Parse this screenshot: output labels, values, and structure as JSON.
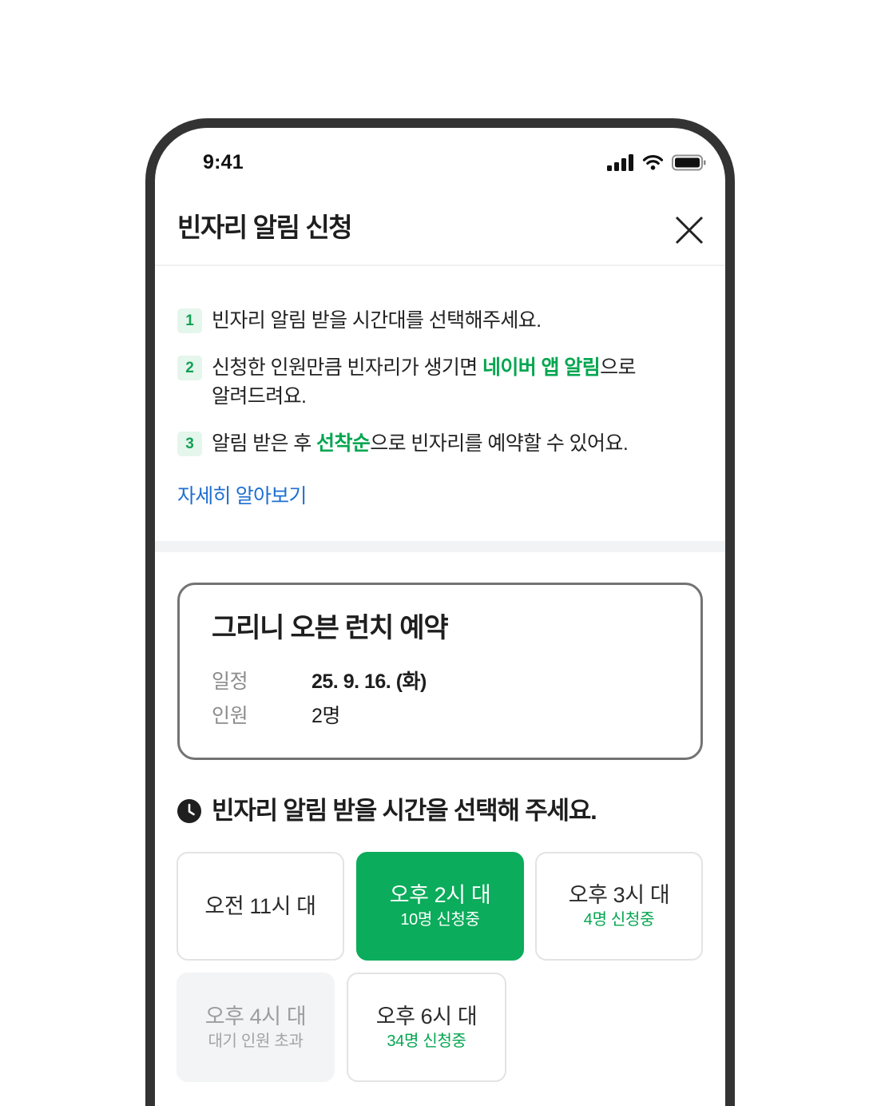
{
  "status_bar": {
    "time": "9:41",
    "icons": [
      "cellular-signal-icon",
      "wifi-icon",
      "battery-icon"
    ]
  },
  "header": {
    "title": "빈자리 알림 신청",
    "close_icon": "close-icon"
  },
  "steps": [
    {
      "number": "1",
      "text": "빈자리 알림 받을 시간대를 선택해주세요."
    },
    {
      "number": "2",
      "before": "신청한 인원만큼 빈자리가 생기면 ",
      "highlight": "네이버 앱 알림",
      "after": "으로 알려드려요."
    },
    {
      "number": "3",
      "before": "알림 받은 후 ",
      "highlight": "선착순",
      "after": "으로 빈자리를 예약할 수 있어요."
    }
  ],
  "learn_more_link": "자세히 알아보기",
  "reservation": {
    "title": "그리니 오븐 런치 예약",
    "rows": [
      {
        "label": "일정",
        "value": "25. 9. 16. (화)"
      },
      {
        "label": "인원",
        "value": "2명"
      }
    ]
  },
  "time_selection": {
    "icon": "clock-icon",
    "heading": "빈자리 알림 받을 시간을 선택해 주세요.",
    "slots": [
      {
        "label": "오전 11시 대"
      },
      {
        "label": "오후 2시 대",
        "status": "10명 신청중",
        "selected": true
      },
      {
        "label": "오후 3시 대",
        "status": "4명 신청중"
      },
      {
        "label": "오후 4시 대",
        "status": "대기 인원 초과",
        "disabled": true
      },
      {
        "label": "오후 6시 대",
        "status": "34명 신청중"
      }
    ]
  },
  "colors": {
    "accent_green": "#0bac5b",
    "highlight_green": "#04a650",
    "badge_background": "#e5f6ec",
    "badge_text": "#12a155",
    "link_blue": "#1f6fd1",
    "device_frame": "#333333"
  }
}
